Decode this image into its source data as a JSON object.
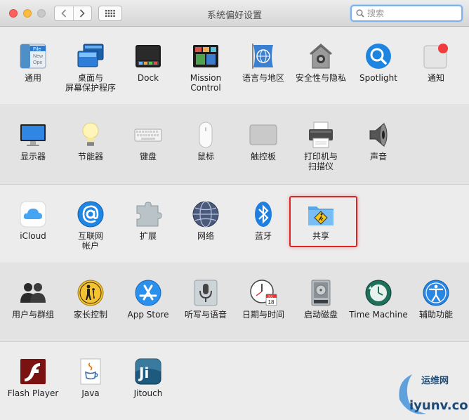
{
  "window": {
    "title": "系统偏好设置",
    "search_placeholder": "搜索"
  },
  "sections": [
    {
      "items": [
        {
          "id": "general",
          "label": "通用",
          "icon": "general-icon"
        },
        {
          "id": "desktop",
          "label": "桌面与\n屏幕保护程序",
          "icon": "desktop-screensaver-icon"
        },
        {
          "id": "dock",
          "label": "Dock",
          "icon": "dock-icon"
        },
        {
          "id": "mission",
          "label": "Mission\nControl",
          "icon": "mission-control-icon"
        },
        {
          "id": "language",
          "label": "语言与地区",
          "icon": "language-region-icon"
        },
        {
          "id": "security",
          "label": "安全性与隐私",
          "icon": "security-privacy-icon"
        },
        {
          "id": "spotlight",
          "label": "Spotlight",
          "icon": "spotlight-icon"
        },
        {
          "id": "notifications",
          "label": "通知",
          "icon": "notifications-icon"
        }
      ]
    },
    {
      "items": [
        {
          "id": "displays",
          "label": "显示器",
          "icon": "displays-icon"
        },
        {
          "id": "energy",
          "label": "节能器",
          "icon": "energy-saver-icon"
        },
        {
          "id": "keyboard",
          "label": "键盘",
          "icon": "keyboard-icon"
        },
        {
          "id": "mouse",
          "label": "鼠标",
          "icon": "mouse-icon"
        },
        {
          "id": "trackpad",
          "label": "触控板",
          "icon": "trackpad-icon"
        },
        {
          "id": "printers",
          "label": "打印机与\n扫描仪",
          "icon": "printer-scanner-icon"
        },
        {
          "id": "sound",
          "label": "声音",
          "icon": "sound-icon"
        }
      ]
    },
    {
      "items": [
        {
          "id": "icloud",
          "label": "iCloud",
          "icon": "icloud-icon"
        },
        {
          "id": "internet",
          "label": "互联网\n帐户",
          "icon": "internet-accounts-icon"
        },
        {
          "id": "extensions",
          "label": "扩展",
          "icon": "extensions-icon"
        },
        {
          "id": "network",
          "label": "网络",
          "icon": "network-icon"
        },
        {
          "id": "bluetooth",
          "label": "蓝牙",
          "icon": "bluetooth-icon"
        },
        {
          "id": "sharing",
          "label": "共享",
          "icon": "sharing-icon"
        }
      ]
    },
    {
      "items": [
        {
          "id": "users",
          "label": "用户与群组",
          "icon": "users-groups-icon"
        },
        {
          "id": "parental",
          "label": "家长控制",
          "icon": "parental-controls-icon"
        },
        {
          "id": "appstore",
          "label": "App Store",
          "icon": "app-store-icon"
        },
        {
          "id": "dictation",
          "label": "听写与语音",
          "icon": "dictation-speech-icon"
        },
        {
          "id": "datetime",
          "label": "日期与时间",
          "icon": "date-time-icon"
        },
        {
          "id": "startup",
          "label": "启动磁盘",
          "icon": "startup-disk-icon"
        },
        {
          "id": "timemachine",
          "label": "Time Machine",
          "icon": "time-machine-icon"
        },
        {
          "id": "accessibility",
          "label": "辅助功能",
          "icon": "accessibility-icon"
        }
      ]
    },
    {
      "items": [
        {
          "id": "flash",
          "label": "Flash Player",
          "icon": "flash-player-icon"
        },
        {
          "id": "java",
          "label": "Java",
          "icon": "java-icon"
        },
        {
          "id": "jitouch",
          "label": "Jitouch",
          "icon": "jitouch-icon"
        }
      ]
    }
  ],
  "icon_text": {
    "general_file": "File",
    "general_new": "New",
    "general_ope": "Ope",
    "calendar_month": "JUL",
    "calendar_day": "18",
    "jitouch_mark": "Ji"
  },
  "highlight_target": "共享",
  "watermark": {
    "cn": "运维网",
    "en": "iyunv.com"
  },
  "colors": {
    "highlight": "#e02424",
    "search_focus": "#7fb1ee"
  }
}
